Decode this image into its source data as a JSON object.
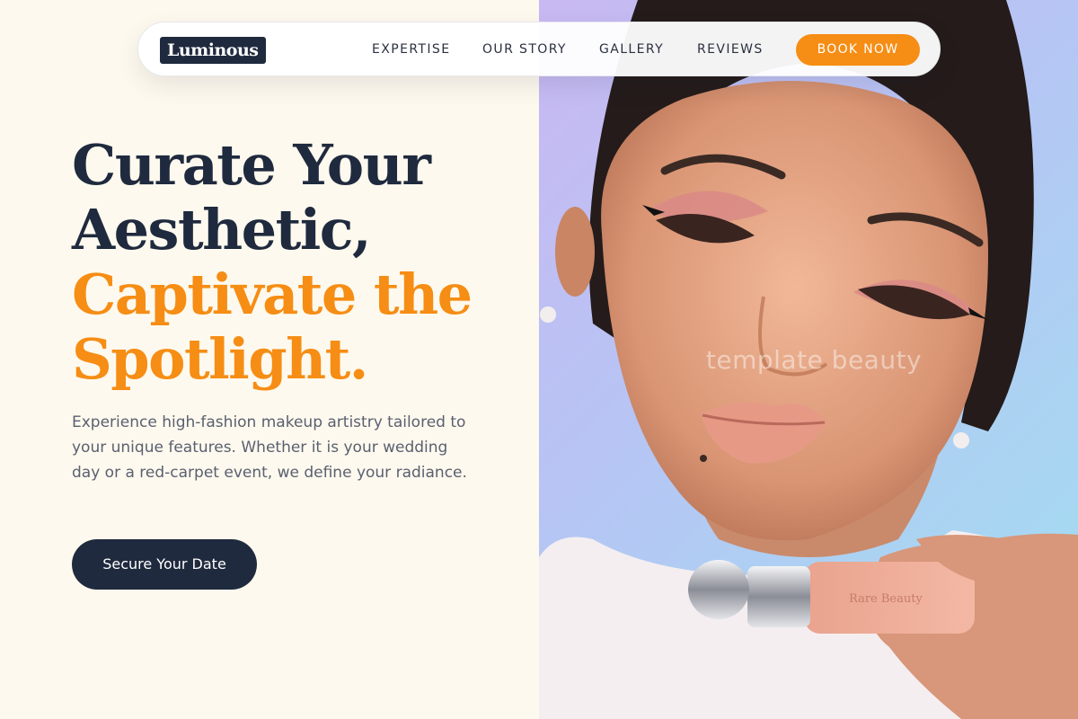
{
  "brand": {
    "logo_text": "Luminous"
  },
  "nav": {
    "links": [
      "EXPERTISE",
      "OUR STORY",
      "GALLERY",
      "REVIEWS"
    ],
    "cta_label": "BOOK NOW"
  },
  "hero": {
    "headline_line1": "Curate Your",
    "headline_line2": "Aesthetic,",
    "headline_line3": "Captivate the",
    "headline_line4": "Spotlight.",
    "description": "Experience high-fashion makeup artistry tailored to your unique features. Whether it is your wedding day or a red-carpet event, we define your radiance.",
    "cta_label": "Secure Your Date",
    "image_watermark": "template beauty",
    "product_label": "Rare Beauty"
  },
  "colors": {
    "accent": "#f68d14",
    "dark": "#1f2a3e",
    "cream": "#fef9ee",
    "body_text": "#5a6070"
  }
}
